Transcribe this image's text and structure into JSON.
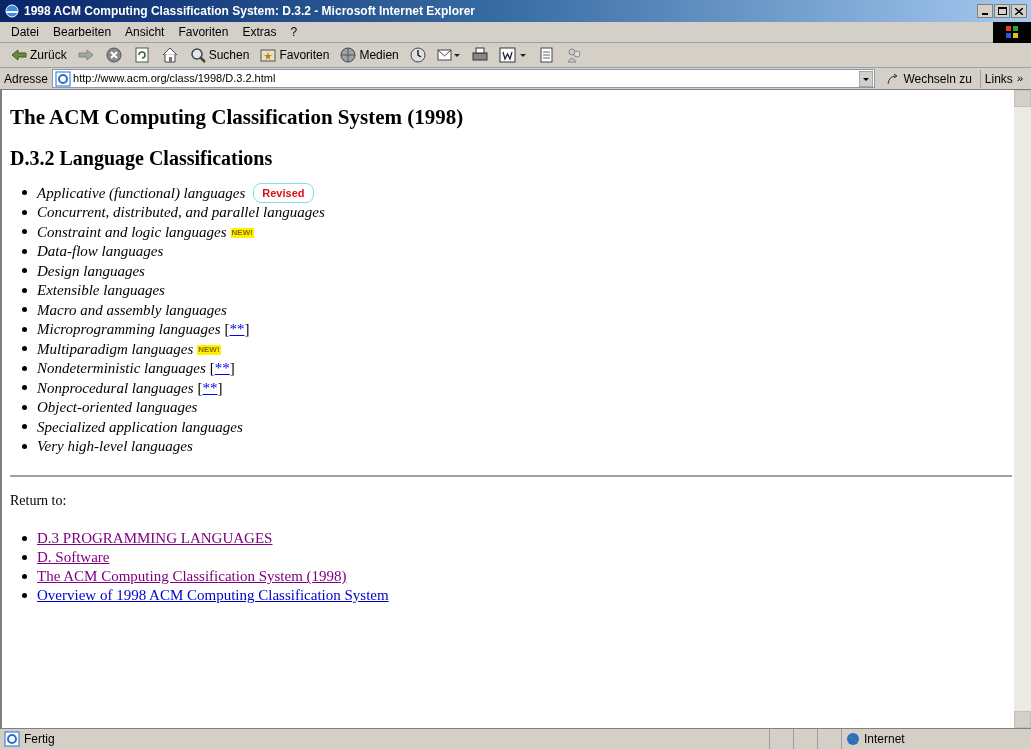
{
  "window": {
    "title": "1998 ACM Computing Classification System: D.3.2 - Microsoft Internet Explorer"
  },
  "menu": [
    "Datei",
    "Bearbeiten",
    "Ansicht",
    "Favoriten",
    "Extras",
    "?"
  ],
  "toolbar": [
    {
      "kind": "back",
      "label": "Zurück"
    },
    {
      "kind": "forward"
    },
    {
      "kind": "stop"
    },
    {
      "kind": "refresh"
    },
    {
      "kind": "home"
    },
    {
      "kind": "search",
      "label": "Suchen"
    },
    {
      "kind": "favorites",
      "label": "Favoriten"
    },
    {
      "kind": "media",
      "label": "Medien"
    },
    {
      "kind": "history"
    },
    {
      "kind": "mail"
    },
    {
      "kind": "print"
    },
    {
      "kind": "edit"
    },
    {
      "kind": "discuss"
    },
    {
      "kind": "messenger"
    }
  ],
  "address": {
    "label": "Adresse",
    "url": "http://www.acm.org/class/1998/D.3.2.html",
    "go": "Wechseln zu",
    "links": "Links",
    "more": "»"
  },
  "page": {
    "title": "The ACM Computing Classification System (1998)",
    "heading": "D.3.2 Language Classifications",
    "items": [
      {
        "text": "Applicative (functional) languages",
        "badge": {
          "kind": "revised",
          "text": "Revised"
        }
      },
      {
        "text": "Concurrent, distributed, and parallel languages"
      },
      {
        "text": "Constraint and logic languages",
        "badge": {
          "kind": "new",
          "text": "NEW!"
        }
      },
      {
        "text": "Data-flow languages"
      },
      {
        "text": "Design languages"
      },
      {
        "text": "Extensible languages"
      },
      {
        "text": "Macro and assembly languages"
      },
      {
        "text": "Microprogramming languages",
        "badge": {
          "kind": "link",
          "open": "[",
          "text": "**",
          "close": "]"
        }
      },
      {
        "text": "Multiparadigm languages",
        "badge": {
          "kind": "new",
          "text": "NEW!"
        }
      },
      {
        "text": "Nondeterministic languages",
        "badge": {
          "kind": "link",
          "open": "[",
          "text": "**",
          "close": "]"
        }
      },
      {
        "text": "Nonprocedural languages",
        "badge": {
          "kind": "link",
          "open": "[",
          "text": "**",
          "close": "]"
        }
      },
      {
        "text": "Object-oriented languages"
      },
      {
        "text": "Specialized application languages"
      },
      {
        "text": "Very high-level languages"
      }
    ],
    "return_label": "Return to:",
    "return_links": [
      {
        "text": "D.3 PROGRAMMING LANGUAGES",
        "visited": true
      },
      {
        "text": "D. Software",
        "visited": true
      },
      {
        "text": "The ACM Computing Classification System (1998)",
        "visited": true
      },
      {
        "text": "Overview of 1998 ACM Computing Classification System",
        "visited": false
      }
    ]
  },
  "status_bar": {
    "text": "Fertig",
    "zone": "Internet"
  }
}
